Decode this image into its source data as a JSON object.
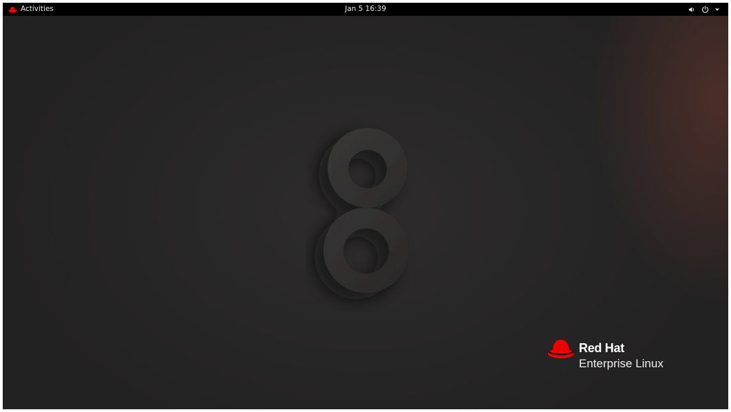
{
  "topbar": {
    "activities_label": "Activities",
    "activities_icon": "redhat-icon",
    "clock": "Jan 5  16:39",
    "status_icons": [
      "volume-icon",
      "power-icon",
      "chevron-down-icon"
    ]
  },
  "desktop": {
    "wallpaper_graphic": "eight-icon",
    "brand": {
      "name": "Red Hat",
      "product": "Enterprise Linux",
      "logo_icon": "redhat-icon"
    }
  },
  "colors": {
    "topbar_bg": "#000000",
    "desktop_bg": "#272626",
    "redhat_red": "#ee0000",
    "accent_warm": "#6e372d"
  }
}
